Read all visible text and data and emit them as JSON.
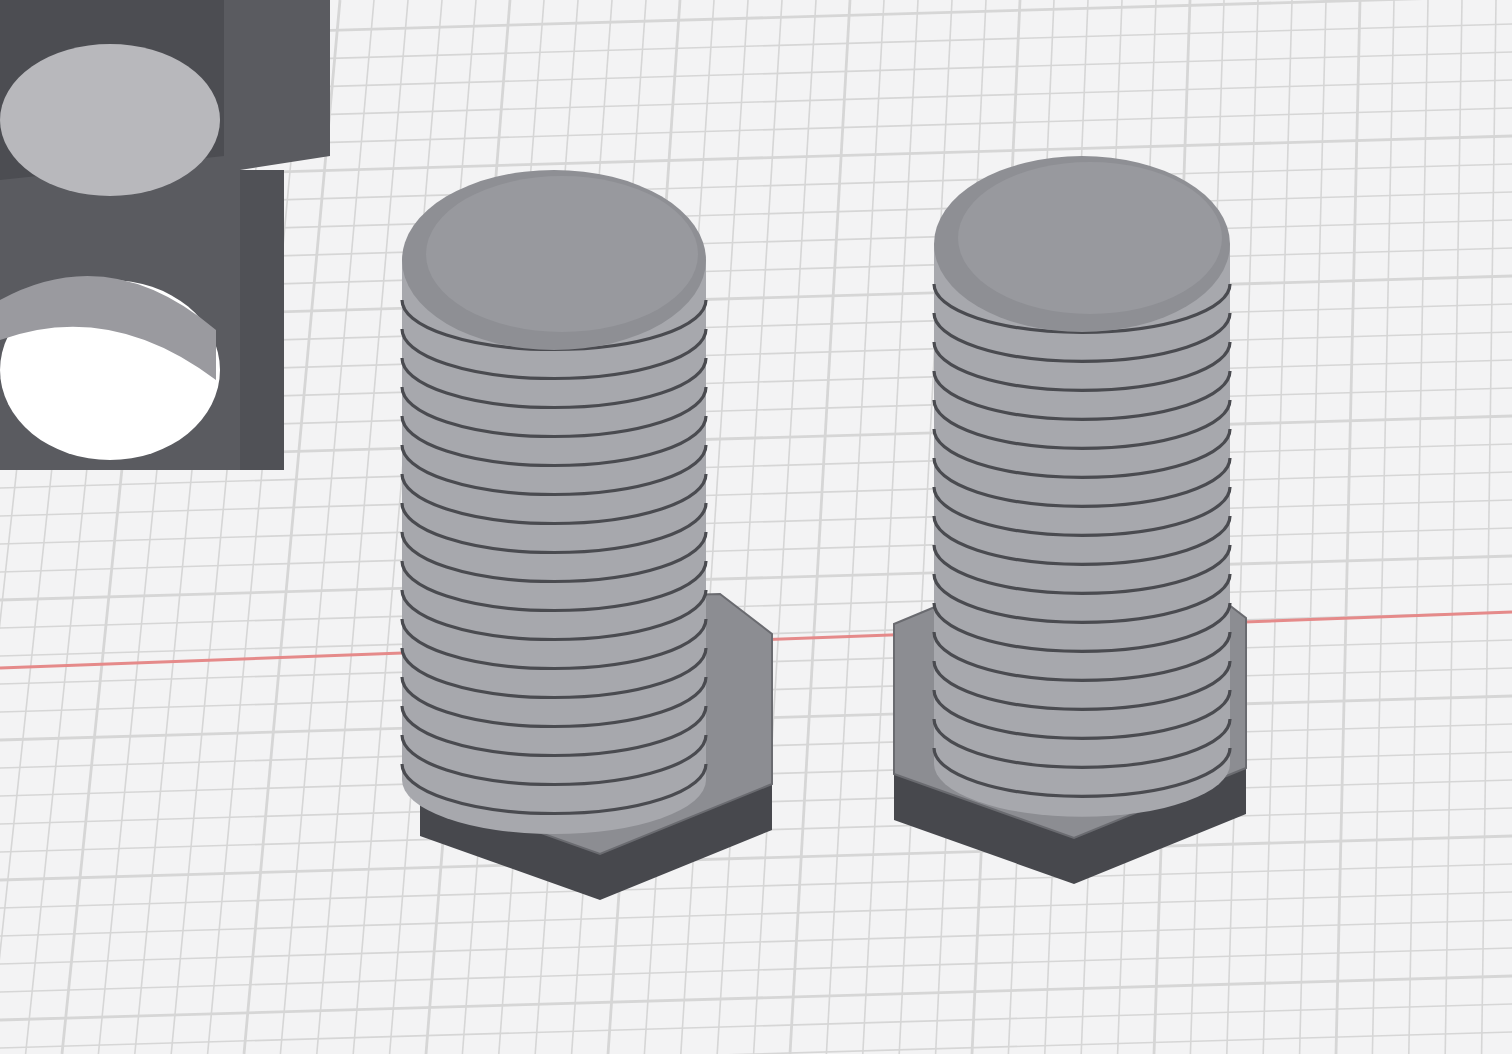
{
  "scene": {
    "objects": [
      {
        "kind": "nut"
      },
      {
        "kind": "bolt"
      },
      {
        "kind": "bolt"
      }
    ]
  }
}
